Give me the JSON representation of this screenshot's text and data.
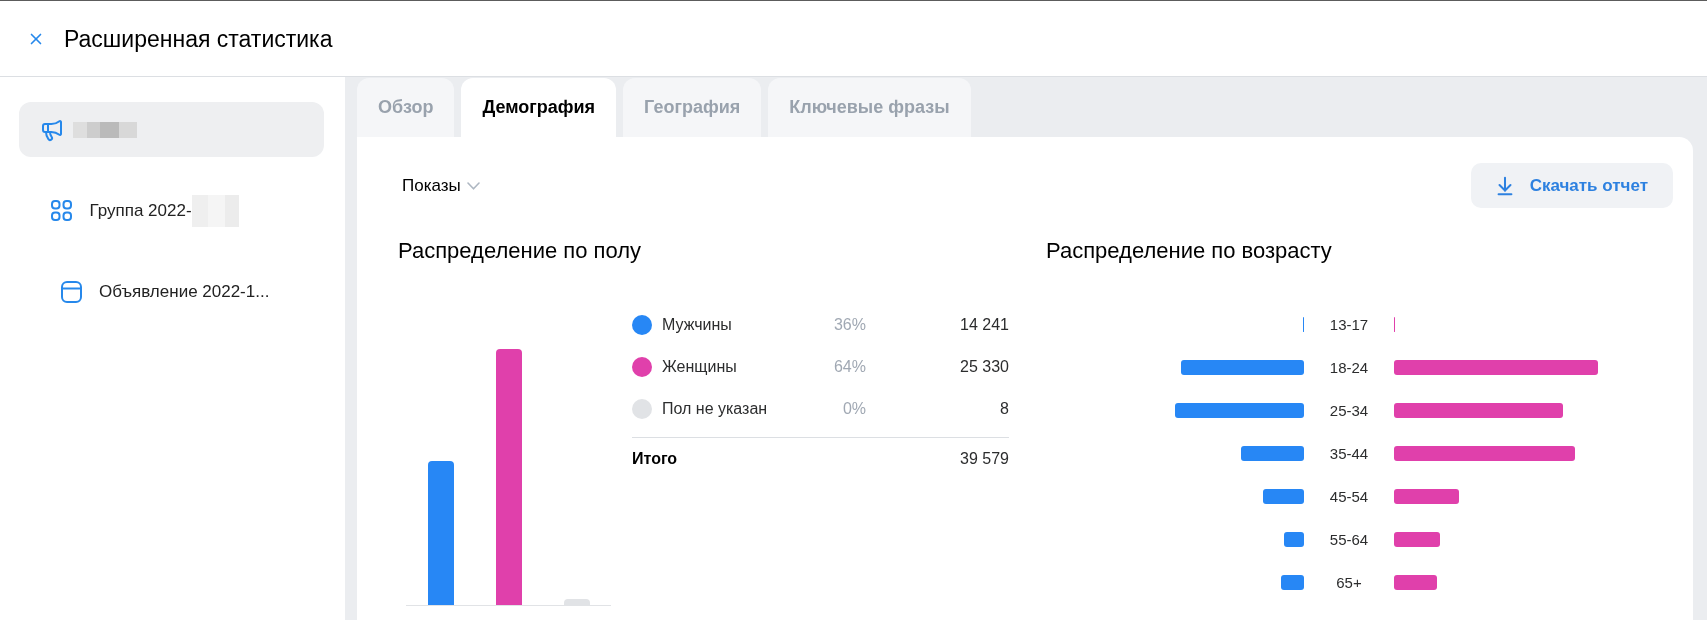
{
  "header": {
    "title": "Расширенная статистика"
  },
  "sidebar": {
    "items": [
      {
        "kind": "campaign",
        "selected": true,
        "redacted": true,
        "children": [
          {
            "kind": "group",
            "label": "Группа 2022-",
            "selected": false,
            "redacted": true,
            "children": [
              {
                "kind": "ad",
                "label": "Объявление 2022-1...",
                "selected": false,
                "redacted": false
              }
            ]
          }
        ]
      }
    ]
  },
  "tabs": [
    {
      "label": "Обзор",
      "selected": false
    },
    {
      "label": "Демография",
      "selected": true
    },
    {
      "label": "География",
      "selected": false
    },
    {
      "label": "Ключевые фразы",
      "selected": false
    }
  ],
  "toolbar": {
    "metric_select": {
      "value": "Показы"
    },
    "download_button": {
      "label": "Скачать отчет"
    }
  },
  "gender_distribution": {
    "title": "Распределение по полу",
    "legend": [
      {
        "label": "Мужчины",
        "percent": "36%",
        "value": "14 241",
        "color": "#2787f5"
      },
      {
        "label": "Женщины",
        "percent": "64%",
        "value": "25 330",
        "color": "#e040ab"
      },
      {
        "label": "Пол не указан",
        "percent": "0%",
        "value": "8",
        "color": "#e1e3e6"
      }
    ],
    "total": {
      "label": "Итого",
      "value": "39 579"
    }
  },
  "age_distribution": {
    "title": "Распределение по возрасту",
    "groups": [
      "13-17",
      "18-24",
      "25-34",
      "35-44",
      "45-54",
      "55-64",
      "65+"
    ]
  }
}
